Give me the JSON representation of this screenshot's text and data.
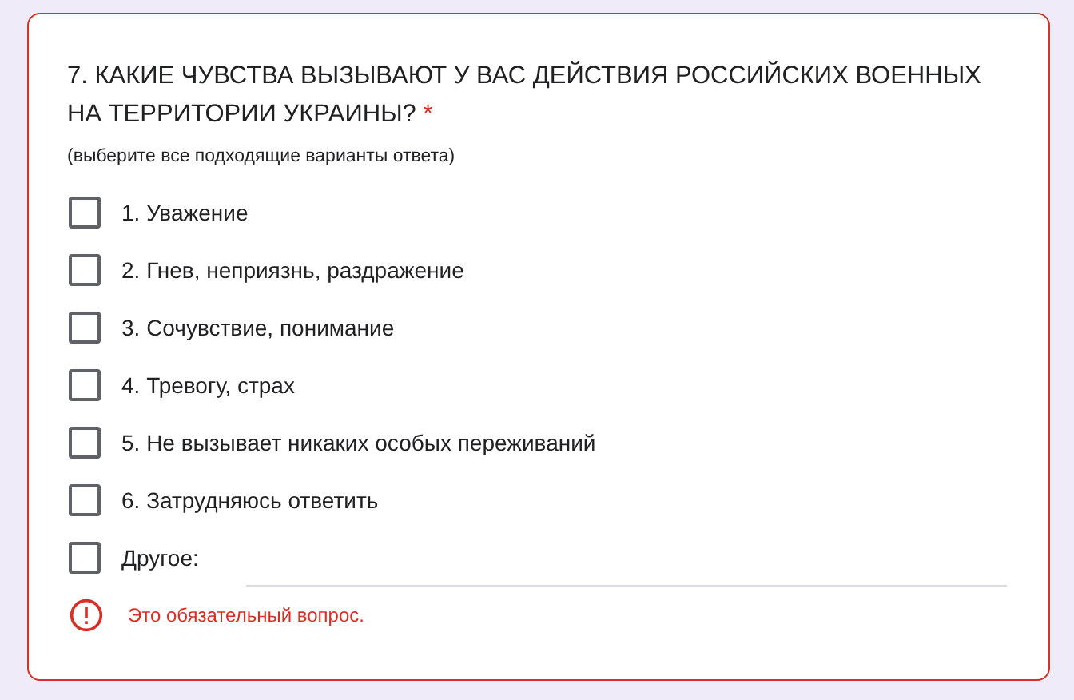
{
  "question": {
    "title": "7. КАКИЕ ЧУВСТВА ВЫЗЫВАЮТ У ВАС ДЕЙСТВИЯ РОССИЙСКИХ ВОЕННЫХ НА ТЕРРИТОРИИ УКРАИНЫ?",
    "required_mark": "*",
    "hint": "(выберите все подходящие варианты ответа)",
    "invalid": true,
    "options": [
      {
        "kind": "option",
        "label": "1. Уважение",
        "checked": false
      },
      {
        "kind": "option",
        "label": "2. Гнев, неприязнь, раздражение",
        "checked": false
      },
      {
        "kind": "option",
        "label": "3. Сочувствие, понимание",
        "checked": false
      },
      {
        "kind": "option",
        "label": "4. Тревогу, страх",
        "checked": false
      },
      {
        "kind": "option",
        "label": "5. Не вызывает никаких особых переживаний",
        "checked": false
      },
      {
        "kind": "option",
        "label": "6. Затрудняюсь ответить",
        "checked": false
      },
      {
        "kind": "other",
        "label": "Другое:",
        "checked": false
      }
    ],
    "error": "Это обязательный вопрос."
  }
}
